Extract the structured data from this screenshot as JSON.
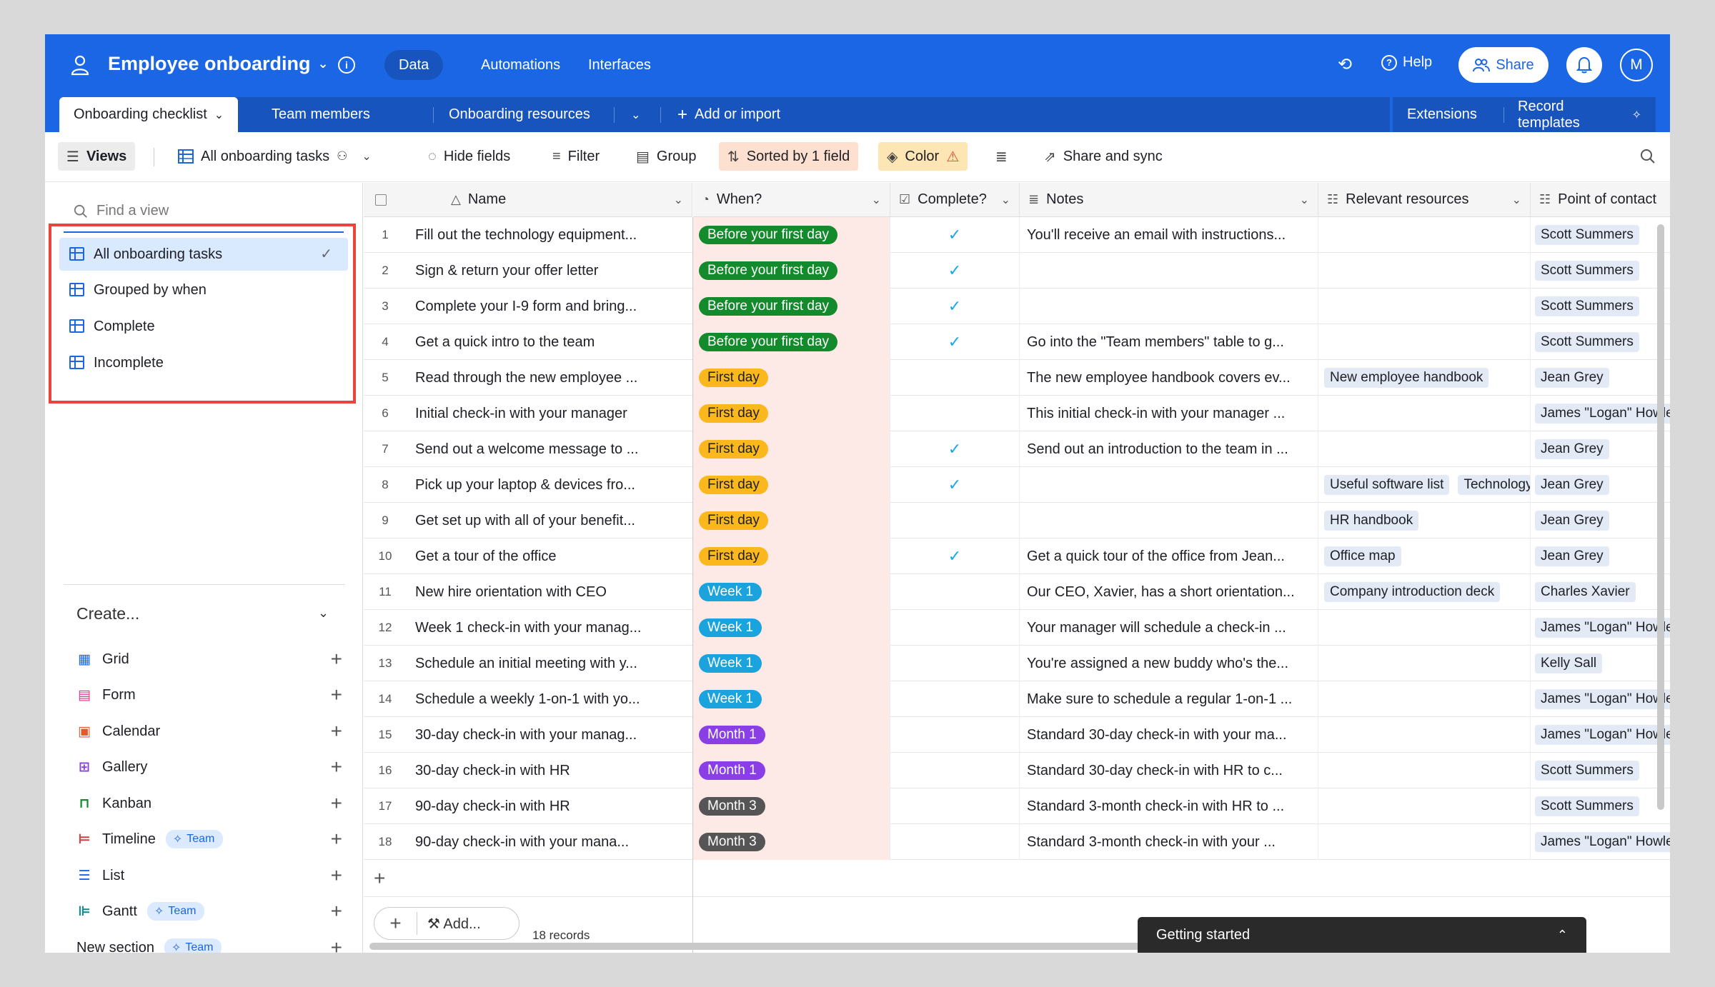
{
  "base": {
    "title": "Employee onboarding"
  },
  "top_nav": {
    "data": "Data",
    "automations": "Automations",
    "interfaces": "Interfaces",
    "help": "Help",
    "share": "Share",
    "avatar": "M"
  },
  "tables": {
    "tab1": "Onboarding checklist",
    "tab2": "Team members",
    "tab3": "Onboarding resources",
    "add": "Add or import",
    "extensions": "Extensions",
    "record_templates": "Record templates"
  },
  "toolbar": {
    "views": "Views",
    "current_view": "All onboarding tasks",
    "hide_fields": "Hide fields",
    "filter": "Filter",
    "group": "Group",
    "sorted": "Sorted by 1 field",
    "color": "Color",
    "share_sync": "Share and sync"
  },
  "sidebar": {
    "find_placeholder": "Find a view",
    "views": [
      "All onboarding tasks",
      "Grouped by when",
      "Complete",
      "Incomplete"
    ],
    "create_label": "Create...",
    "create_items": [
      "Grid",
      "Form",
      "Calendar",
      "Gallery",
      "Kanban",
      "Timeline",
      "List",
      "Gantt"
    ],
    "new_section": "New section",
    "team_badge": "Team"
  },
  "columns": {
    "name": "Name",
    "when": "When?",
    "complete": "Complete?",
    "notes": "Notes",
    "resources": "Relevant resources",
    "poc": "Point of contact"
  },
  "when_colors": {
    "Before your first day": "#138a2b",
    "First day": "#fbb81d",
    "Week 1": "#1aa3dd",
    "Month 1": "#8a3ee6",
    "Month 3": "#555555"
  },
  "rows": [
    {
      "n": "1",
      "name": "Fill out the technology equipment...",
      "when": "Before your first day",
      "done": "✓",
      "notes": "You'll receive an email with instructions...",
      "res": [],
      "poc": "Scott Summers"
    },
    {
      "n": "2",
      "name": "Sign & return your offer letter",
      "when": "Before your first day",
      "done": "✓",
      "notes": "",
      "res": [],
      "poc": "Scott Summers"
    },
    {
      "n": "3",
      "name": "Complete your I-9 form and bring...",
      "when": "Before your first day",
      "done": "✓",
      "notes": "",
      "res": [],
      "poc": "Scott Summers"
    },
    {
      "n": "4",
      "name": "Get a quick intro to the team",
      "when": "Before your first day",
      "done": "✓",
      "notes": "Go into the \"Team members\" table to g...",
      "res": [],
      "poc": "Scott Summers"
    },
    {
      "n": "5",
      "name": "Read through the new employee ...",
      "when": "First day",
      "done": "",
      "notes": "The new employee handbook covers ev...",
      "res": [
        "New employee handbook"
      ],
      "poc": "Jean Grey"
    },
    {
      "n": "6",
      "name": "Initial check-in with your manager",
      "when": "First day",
      "done": "",
      "notes": "This initial check-in with your manager ...",
      "res": [],
      "poc": "James \"Logan\" Howlett"
    },
    {
      "n": "7",
      "name": "Send out a welcome message to ...",
      "when": "First day",
      "done": "✓",
      "notes": "Send out an introduction to the team in ...",
      "res": [],
      "poc": "Jean Grey"
    },
    {
      "n": "8",
      "name": "Pick up your laptop & devices fro...",
      "when": "First day",
      "done": "✓",
      "notes": "",
      "res": [
        "Useful software list",
        "Technology"
      ],
      "poc": "Jean Grey"
    },
    {
      "n": "9",
      "name": "Get set up with all of your benefit...",
      "when": "First day",
      "done": "",
      "notes": "",
      "res": [
        "HR handbook"
      ],
      "poc": "Jean Grey"
    },
    {
      "n": "10",
      "name": "Get a tour of the office",
      "when": "First day",
      "done": "✓",
      "notes": "Get a quick tour of the office from Jean...",
      "res": [
        "Office map"
      ],
      "poc": "Jean Grey"
    },
    {
      "n": "11",
      "name": "New hire orientation with CEO",
      "when": "Week 1",
      "done": "",
      "notes": "Our CEO, Xavier, has a short orientation...",
      "res": [
        "Company introduction deck"
      ],
      "poc": "Charles Xavier"
    },
    {
      "n": "12",
      "name": "Week 1 check-in with your manag...",
      "when": "Week 1",
      "done": "",
      "notes": "Your manager will schedule a check-in ...",
      "res": [],
      "poc": "James \"Logan\" Howlett"
    },
    {
      "n": "13",
      "name": "Schedule an initial meeting with y...",
      "when": "Week 1",
      "done": "",
      "notes": "You're assigned a new buddy who's the...",
      "res": [],
      "poc": "Kelly Sall"
    },
    {
      "n": "14",
      "name": "Schedule a weekly 1-on-1 with yo...",
      "when": "Week 1",
      "done": "",
      "notes": "Make sure to schedule a regular 1-on-1 ...",
      "res": [],
      "poc": "James \"Logan\" Howlett"
    },
    {
      "n": "15",
      "name": "30-day check-in with your manag...",
      "when": "Month 1",
      "done": "",
      "notes": "Standard 30-day check-in with your ma...",
      "res": [],
      "poc": "James \"Logan\" Howlett"
    },
    {
      "n": "16",
      "name": "30-day check-in with HR",
      "when": "Month 1",
      "done": "",
      "notes": "Standard 30-day check-in with HR to c...",
      "res": [],
      "poc": "Scott Summers"
    },
    {
      "n": "17",
      "name": "90-day check-in with HR",
      "when": "Month 3",
      "done": "",
      "notes": "Standard 3-month check-in with HR to ...",
      "res": [],
      "poc": "Scott Summers"
    },
    {
      "n": "18",
      "name": "90-day check-in with your mana...",
      "when": "Month 3",
      "done": "",
      "notes": "Standard 3-month check-in with your ...",
      "res": [],
      "poc": "James \"Logan\" Howlett"
    }
  ],
  "footer": {
    "add": "Add...",
    "records": "18 records"
  },
  "getting_started": "Getting started"
}
